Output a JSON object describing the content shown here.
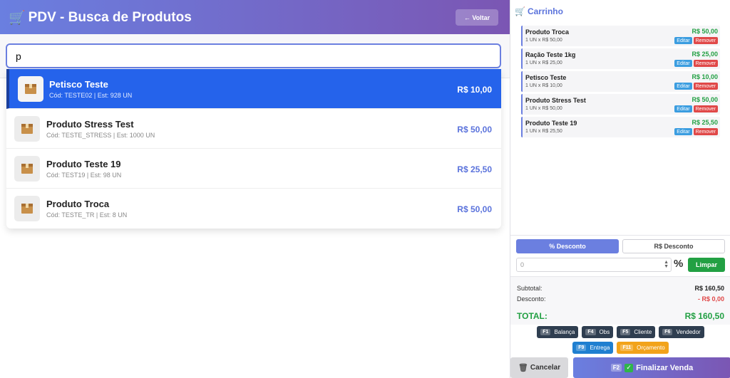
{
  "header": {
    "title": "PDV - Busca de Produtos",
    "cart_icon": "cart-icon",
    "back_label": "← Voltar"
  },
  "search": {
    "value": "p",
    "placeholder": ""
  },
  "results": [
    {
      "name": "Petisco Teste",
      "meta": "Cód: TESTE02 | Est: 928 UN",
      "price": "R$ 10,00",
      "selected": true
    },
    {
      "name": "Produto Stress Test",
      "meta": "Cód: TESTE_STRESS | Est: 1000 UN",
      "price": "R$ 50,00"
    },
    {
      "name": "Produto Teste 19",
      "meta": "Cód: TEST19 | Est: 98 UN",
      "price": "R$ 25,50"
    },
    {
      "name": "Produto Troca",
      "meta": "Cód: TESTE_TR | Est: 8 UN",
      "price": "R$ 50,00"
    }
  ],
  "cart": {
    "title": "Carrinho",
    "items": [
      {
        "name": "Produto Troca",
        "qty": "1 UN x R$ 50,00",
        "price": "R$ 50,00",
        "edit": "Editar",
        "remove": "Remover"
      },
      {
        "name": "Ração Teste 1kg",
        "qty": "1 UN x R$ 25,00",
        "price": "R$ 25,00",
        "edit": "Editar",
        "remove": "Remover"
      },
      {
        "name": "Petisco Teste",
        "qty": "1 UN x R$ 10,00",
        "price": "R$ 10,00",
        "edit": "Editar",
        "remove": "Remover"
      },
      {
        "name": "Produto Stress Test",
        "qty": "1 UN x R$ 50,00",
        "price": "R$ 50,00",
        "edit": "Editar",
        "remove": "Remover"
      },
      {
        "name": "Produto Teste 19",
        "qty": "1 UN x R$ 25,50",
        "price": "R$ 25,50",
        "edit": "Editar",
        "remove": "Remover"
      }
    ]
  },
  "discount": {
    "pct_tab": "% Desconto",
    "abs_tab": "R$ Desconto",
    "value": "0",
    "pct_symbol": "%",
    "clear_label": "Limpar"
  },
  "totals": {
    "subtotal_label": "Subtotal:",
    "subtotal_value": "R$ 160,50",
    "desconto_label": "Desconto:",
    "desconto_value": "- R$ 0,00",
    "total_label": "TOTAL:",
    "total_value": "R$ 160,50"
  },
  "shortcuts": {
    "f1": {
      "key": "F1",
      "label": "Balança"
    },
    "f4": {
      "key": "F4",
      "label": "Obs"
    },
    "f5": {
      "key": "F5",
      "label": "Cliente"
    },
    "f6": {
      "key": "F6",
      "label": "Vendedor"
    },
    "f9": {
      "key": "F9",
      "label": "Entrega"
    },
    "f11": {
      "key": "F11",
      "label": "Orçamento"
    }
  },
  "actions": {
    "cancel_label": "Cancelar",
    "finish_key": "F2",
    "finish_label": "Finalizar Venda"
  },
  "colors": {
    "accent": "#6b7fe0",
    "selected_row": "#2563eb",
    "price_green": "#22a043",
    "danger": "#e04848"
  }
}
